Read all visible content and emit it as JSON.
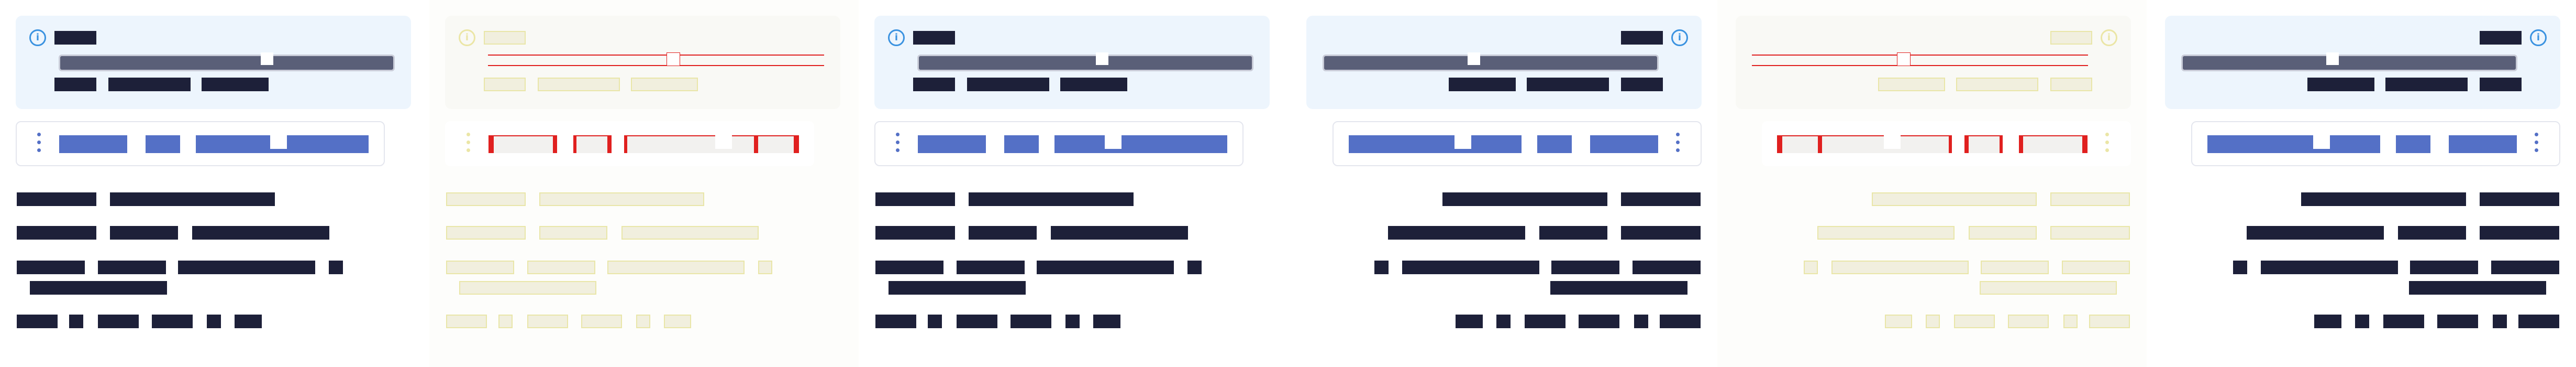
{
  "screen": {
    "title": ""
  },
  "theme": {
    "dark_bar": "#1d2039",
    "accent_blue": "#5470c6",
    "slider_track": "#5a5f78",
    "callout_bg": "#edf5fd",
    "info_blue": "#3a92e0",
    "ghost_fill": "#f1efde",
    "ghost_border": "#e9e6a8",
    "error_red": "#e0201f"
  },
  "icons": {
    "info": "info-circle-icon",
    "menu": "vertical-ellipsis-icon",
    "handle": "slider-thumb"
  },
  "panels": [
    {
      "id": "panel-1",
      "direction": "ltr",
      "style": "normal",
      "slider_value": 0.62,
      "range_value": 0.48
    },
    {
      "id": "panel-2",
      "direction": "ltr",
      "style": "debug",
      "slider_value": 0.55,
      "range_value": 0.57
    },
    {
      "id": "panel-3",
      "direction": "ltr",
      "style": "normal",
      "slider_value": 0.55,
      "range_value": 0.34
    },
    {
      "id": "panel-4",
      "direction": "rtl",
      "style": "normal",
      "slider_value": 0.55,
      "range_value": 0.34
    },
    {
      "id": "panel-5",
      "direction": "rtl",
      "style": "debug",
      "slider_value": 0.55,
      "range_value": 0.34
    },
    {
      "id": "panel-6",
      "direction": "rtl",
      "style": "normal",
      "slider_value": 0.55,
      "range_value": 0.34
    }
  ]
}
